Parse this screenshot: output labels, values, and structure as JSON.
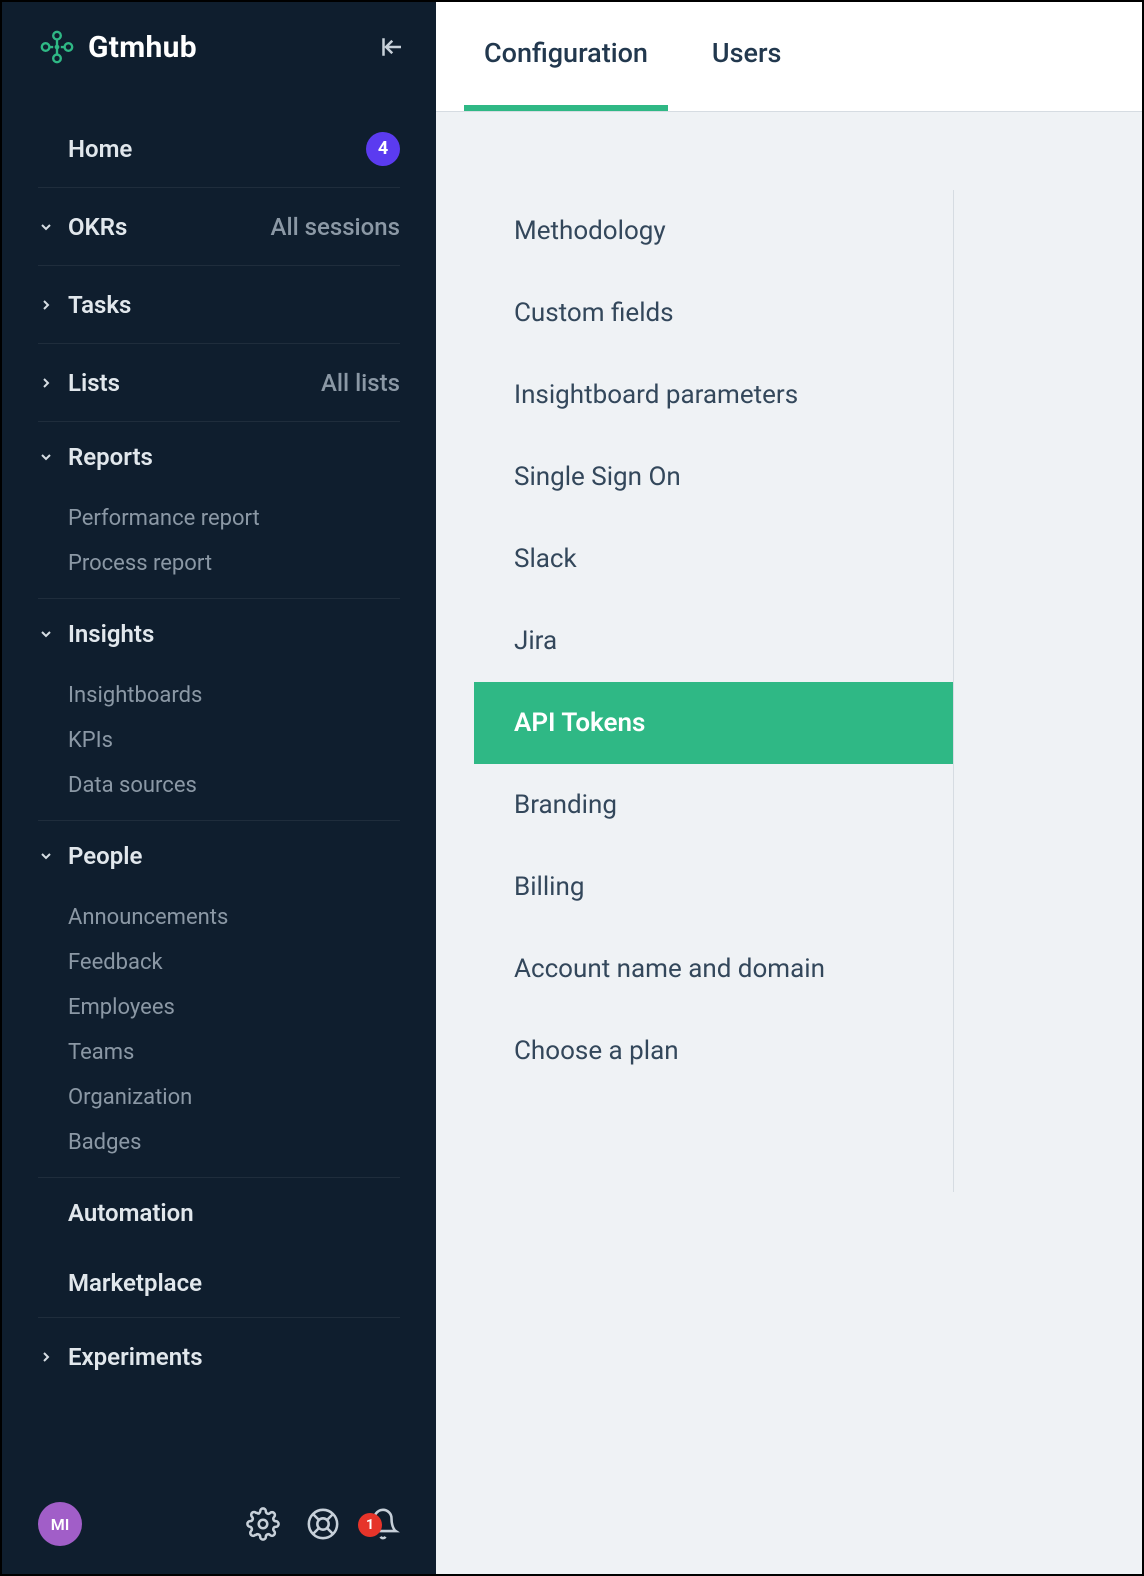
{
  "app": {
    "name": "Gtmhub"
  },
  "sidebar": {
    "home": {
      "label": "Home",
      "badge": "4"
    },
    "okrs": {
      "label": "OKRs",
      "right": "All sessions"
    },
    "tasks": {
      "label": "Tasks"
    },
    "lists": {
      "label": "Lists",
      "right": "All lists"
    },
    "reports": {
      "label": "Reports",
      "items": [
        "Performance report",
        "Process report"
      ]
    },
    "insights": {
      "label": "Insights",
      "items": [
        "Insightboards",
        "KPIs",
        "Data sources"
      ]
    },
    "people": {
      "label": "People",
      "items": [
        "Announcements",
        "Feedback",
        "Employees",
        "Teams",
        "Organization",
        "Badges"
      ]
    },
    "automation": {
      "label": "Automation"
    },
    "marketplace": {
      "label": "Marketplace"
    },
    "experiments": {
      "label": "Experiments"
    }
  },
  "footer": {
    "avatar_initials": "MI",
    "notification_count": "1"
  },
  "main": {
    "tabs": {
      "configuration": "Configuration",
      "users": "Users"
    },
    "settings": [
      "Methodology",
      "Custom fields",
      "Insightboard parameters",
      "Single Sign On",
      "Slack",
      "Jira",
      "API Tokens",
      "Branding",
      "Billing",
      "Account name and domain",
      "Choose a plan"
    ],
    "selected_setting": "API Tokens"
  }
}
